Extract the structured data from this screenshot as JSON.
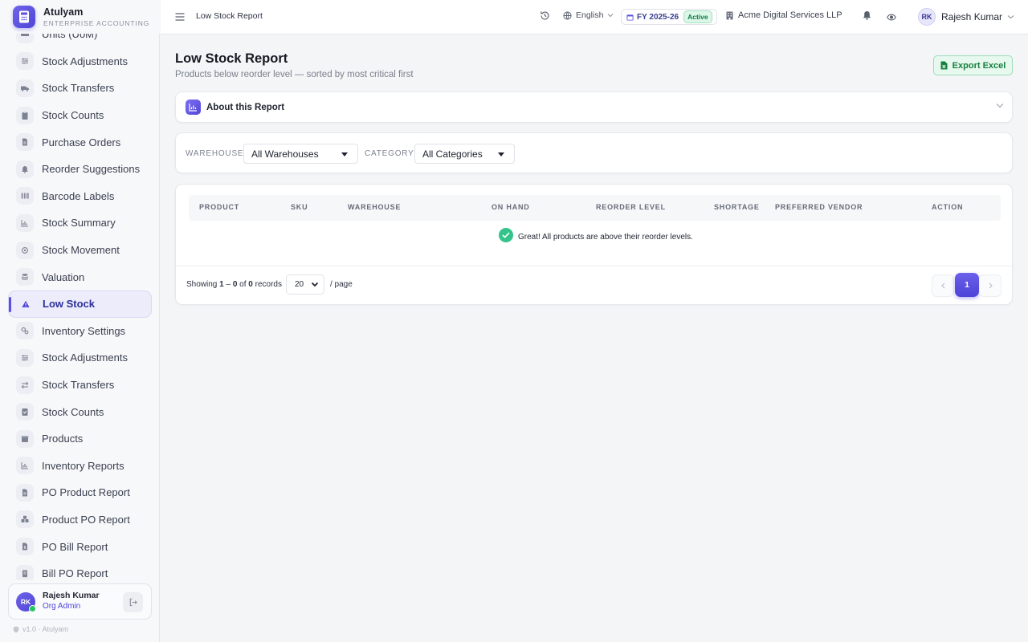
{
  "brand": {
    "name": "Atulyam",
    "subtitle": "ENTERPRISE ACCOUNTING"
  },
  "sidebar": {
    "items": [
      {
        "label": "Units (UoM)",
        "icon": "ruler-icon"
      },
      {
        "label": "Stock Adjustments",
        "icon": "sliders-icon"
      },
      {
        "label": "Stock Transfers",
        "icon": "truck-icon"
      },
      {
        "label": "Stock Counts",
        "icon": "clipboard-icon"
      },
      {
        "label": "Purchase Orders",
        "icon": "document-icon"
      },
      {
        "label": "Reorder Suggestions",
        "icon": "bell-icon"
      },
      {
        "label": "Barcode Labels",
        "icon": "barcode-icon"
      },
      {
        "label": "Stock Summary",
        "icon": "bar-chart-icon"
      },
      {
        "label": "Stock Movement",
        "icon": "refresh-icon"
      },
      {
        "label": "Valuation",
        "icon": "coins-icon"
      },
      {
        "label": "Low Stock",
        "icon": "warning-icon",
        "active": true
      },
      {
        "label": "Inventory Settings",
        "icon": "gears-icon"
      },
      {
        "label": "Stock Adjustments",
        "icon": "sliders-icon"
      },
      {
        "label": "Stock Transfers",
        "icon": "arrows-swap-icon"
      },
      {
        "label": "Stock Counts",
        "icon": "clipboard-check-icon"
      },
      {
        "label": "Products",
        "icon": "box-icon"
      },
      {
        "label": "Inventory Reports",
        "icon": "bar-chart-icon"
      },
      {
        "label": "PO Product Report",
        "icon": "document-icon"
      },
      {
        "label": "Product PO Report",
        "icon": "boxes-icon"
      },
      {
        "label": "PO Bill Report",
        "icon": "bill-icon"
      },
      {
        "label": "Bill PO Report",
        "icon": "receipt-icon"
      }
    ],
    "user": {
      "initials": "RK",
      "name": "Rajesh Kumar",
      "role": "Org Admin"
    },
    "version": "v1.0 · Atulyam"
  },
  "topbar": {
    "breadcrumb": "Low Stock Report",
    "language": "English",
    "fiscal_year": "FY 2025-26",
    "fiscal_status": "Active",
    "organization": "Acme Digital Services LLP",
    "user_initials": "RK",
    "user_name": "Rajesh Kumar"
  },
  "page": {
    "title": "Low Stock Report",
    "subtitle": "Products below reorder level — sorted by most critical first",
    "export_label": "Export Excel",
    "about_label": "About this Report"
  },
  "filters": {
    "warehouse_label": "WAREHOUSE",
    "warehouse_value": "All Warehouses",
    "category_label": "CATEGORY",
    "category_value": "All Categories"
  },
  "table": {
    "columns": [
      "PRODUCT",
      "SKU",
      "WAREHOUSE",
      "ON HAND",
      "REORDER LEVEL",
      "SHORTAGE",
      "PREFERRED VENDOR",
      "ACTION"
    ],
    "rows": [],
    "empty_message": "Great! All products are above their reorder levels."
  },
  "pagination": {
    "showing_prefix": "Showing",
    "range_start": "1",
    "range_end": "0",
    "total": "0",
    "records_label": "records",
    "per_page": "20",
    "per_page_label": "/ page",
    "current_page": "1"
  },
  "colors": {
    "accent": "#5b50e2",
    "success": "#15803d",
    "background": "#f4f5f7"
  }
}
